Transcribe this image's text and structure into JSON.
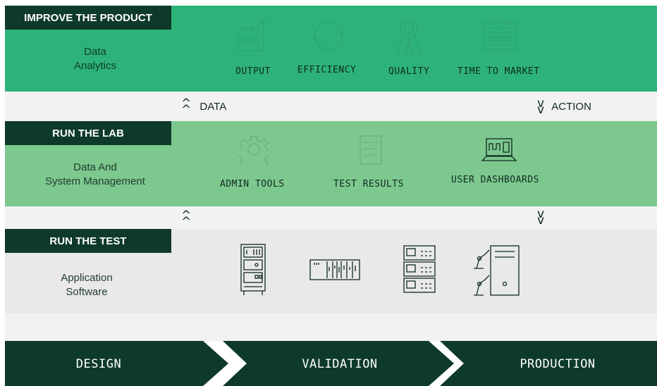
{
  "colors": {
    "top_band": "#2db37a",
    "mid_band": "#7dc88e",
    "bottom_band": "#e9e9e9",
    "gap_band": "#f2f2f2",
    "dark": "#0e3a2a"
  },
  "improve": {
    "tag": "IMPROVE THE PRODUCT",
    "subtitle_line1": "Data",
    "subtitle_line2": "Analytics",
    "items": [
      {
        "label": "OUTPUT",
        "icon": "factory-icon"
      },
      {
        "label": "EFFICIENCY",
        "icon": "cycle-icon"
      },
      {
        "label": "QUALITY",
        "icon": "award-ribbon-icon"
      },
      {
        "label": "TIME TO MARKET",
        "icon": "calendar-icon"
      }
    ]
  },
  "flow1": {
    "up_label": "DATA",
    "down_label": "ACTION"
  },
  "lab": {
    "tag": "RUN THE LAB",
    "subtitle_line1": "Data And",
    "subtitle_line2": "System Management",
    "items": [
      {
        "label": "ADMIN TOOLS",
        "icon": "gear-icon"
      },
      {
        "label": "TEST RESULTS",
        "icon": "checklist-icon"
      },
      {
        "label": "USER DASHBOARDS",
        "icon": "laptop-dashboard-icon"
      }
    ]
  },
  "test": {
    "tag": "RUN THE TEST",
    "subtitle_line1": "Application",
    "subtitle_line2": "Software",
    "icons": [
      "test-rack-icon",
      "daq-chassis-icon",
      "instrument-stack-icon",
      "robot-tower-icon"
    ]
  },
  "pipeline": {
    "stages": [
      "DESIGN",
      "VALIDATION",
      "PRODUCTION"
    ]
  }
}
